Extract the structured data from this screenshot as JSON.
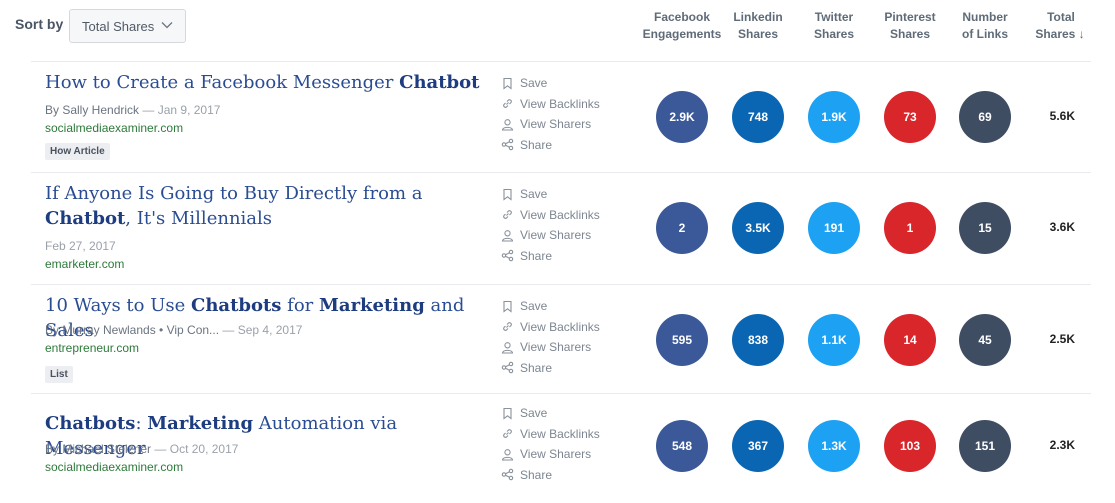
{
  "sort": {
    "label": "Sort by",
    "selected": "Total Shares"
  },
  "columns": [
    {
      "line1": "Facebook",
      "line2": "Engagements"
    },
    {
      "line1": "Linkedin",
      "line2": "Shares"
    },
    {
      "line1": "Twitter",
      "line2": "Shares"
    },
    {
      "line1": "Pinterest",
      "line2": "Shares"
    },
    {
      "line1": "Number",
      "line2": "of Links"
    },
    {
      "line1": "Total",
      "line2": "Shares",
      "arrow": "↓"
    }
  ],
  "actions": {
    "save": "Save",
    "backlinks": "View Backlinks",
    "sharers": "View Sharers",
    "share": "Share"
  },
  "articles": [
    {
      "title_parts": [
        {
          "t": "How to Create a Facebook Messenger ",
          "b": false
        },
        {
          "t": "Chatbot",
          "b": true
        }
      ],
      "author": "By Sally Hendrick",
      "date": "Jan 9, 2017",
      "domain": "socialmediaexaminer.com",
      "tag": "How Article",
      "facebook": "2.9K",
      "linkedin": "748",
      "twitter": "1.9K",
      "pinterest": "73",
      "links": "69",
      "total": "5.6K"
    },
    {
      "title_parts": [
        {
          "t": "If Anyone Is Going to Buy Directly from a ",
          "b": false
        },
        {
          "t": "Chatbot",
          "b": true
        },
        {
          "t": ", It's Millennials",
          "b": false
        }
      ],
      "author": "",
      "date": "Feb 27, 2017",
      "domain": "emarketer.com",
      "tag": "",
      "facebook": "2",
      "linkedin": "3.5K",
      "twitter": "191",
      "pinterest": "1",
      "links": "15",
      "total": "3.6K"
    },
    {
      "title_parts": [
        {
          "t": "10 Ways to Use ",
          "b": false
        },
        {
          "t": "Chatbots",
          "b": true
        },
        {
          "t": " for ",
          "b": false
        },
        {
          "t": "Marketing",
          "b": true
        },
        {
          "t": " and Sales",
          "b": false
        }
      ],
      "author": "By Murray Newlands • Vip Con...",
      "date": "Sep 4, 2017",
      "domain": "entrepreneur.com",
      "tag": "List",
      "facebook": "595",
      "linkedin": "838",
      "twitter": "1.1K",
      "pinterest": "14",
      "links": "45",
      "total": "2.5K"
    },
    {
      "title_parts": [
        {
          "t": "Chatbots",
          "b": true
        },
        {
          "t": ": ",
          "b": false
        },
        {
          "t": "Marketing",
          "b": true
        },
        {
          "t": " Automation via Messenger",
          "b": false
        }
      ],
      "author": "By Michael Stelzner",
      "date": "Oct 20, 2017",
      "domain": "socialmediaexaminer.com",
      "tag": "",
      "facebook": "548",
      "linkedin": "367",
      "twitter": "1.3K",
      "pinterest": "103",
      "links": "151",
      "total": "2.3K"
    }
  ]
}
